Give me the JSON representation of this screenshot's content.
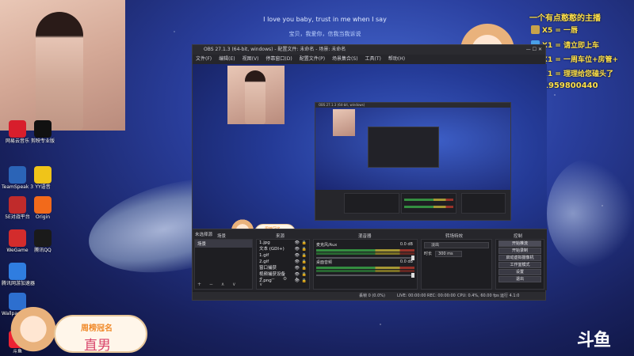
{
  "lyrics": {
    "line1": "I love you baby, trust in me when I say",
    "line2": "宝贝，我爱你，信我当我诉说"
  },
  "desktop_icons": [
    {
      "label": "网易云音乐",
      "color": "#d81e2c"
    },
    {
      "label": "剪映专业版",
      "color": "#111111"
    },
    {
      "label": "TeamSpeak 3",
      "color": "#2b64b7"
    },
    {
      "label": "YY语音",
      "color": "#f0c419"
    },
    {
      "label": "5E对战平台",
      "color": "#c02b2b"
    },
    {
      "label": "Origin",
      "color": "#f26a1b"
    },
    {
      "label": "WeGame",
      "color": "#d32c2c"
    },
    {
      "label": "腾讯QQ",
      "color": "#1a1a1a"
    },
    {
      "label": "腾讯网游加速器",
      "color": "#2f7de0"
    },
    {
      "label": "Wallpaper Engine",
      "color": "#2d6fcf"
    },
    {
      "label": "斗鱼",
      "color": "#e23"
    }
  ],
  "gift_panel": {
    "title": "一个有点憨憨的主播",
    "rows": [
      "X5 = 一唇",
      "X1 = 请立即上车",
      "X1 = 一周车位+房管+",
      "X1 = 理理给您磕头了"
    ],
    "phone": "1959800440"
  },
  "banner": {
    "line1": "周榜冠名",
    "line2": "直男"
  },
  "watermark": "斗鱼",
  "obs": {
    "title": "OBS 27.1.3 (64-bit, windows) - 配置文件: 未命名 - 场景: 未命名",
    "window_controls": "— ☐ ✕",
    "menu": [
      "文件(F)",
      "编辑(E)",
      "视图(V)",
      "停靠窗口(D)",
      "配置文件(P)",
      "场景集合(S)",
      "工具(T)",
      "帮助(H)"
    ],
    "preview_banner": {
      "line1": "周榜冠名",
      "line2": "直男"
    },
    "preview_watermark": "斗鱼",
    "filter_button": "滤镜",
    "properties_button": "属性",
    "no_source": "未选择源",
    "scenes": {
      "header": "场景",
      "items": [
        "场景"
      ]
    },
    "sources": {
      "header": "来源",
      "items": [
        "1.jpg",
        "文本 (GDI+)",
        "1.gif",
        "2.gif",
        "窗口捕获",
        "视频捕获设备",
        "2.png"
      ]
    },
    "mixer": {
      "header": "混音器",
      "tracks": [
        {
          "name": "麦克风/Aux",
          "value": "0.0 dB"
        },
        {
          "name": "桌面音频",
          "value": "0.0 dB"
        }
      ]
    },
    "transitions": {
      "header": "转场特效",
      "type": "淡出",
      "duration_label": "时长",
      "duration": "300 ms"
    },
    "controls": {
      "header": "控制",
      "buttons": [
        "开始推流",
        "开始录制",
        "启动虚拟摄像机",
        "工作室模式",
        "设置",
        "退出"
      ]
    },
    "status": {
      "dropped": "丢帧 0 (0.0%)",
      "live": "LIVE: 00:00:00",
      "rec": "REC: 00:00:00",
      "cpu": "CPU: 0.4%, 60.00 fps",
      "extra": "运行 4.1:0"
    },
    "nested_title": "OBS 27.1.3 (64-bit, windows)"
  }
}
